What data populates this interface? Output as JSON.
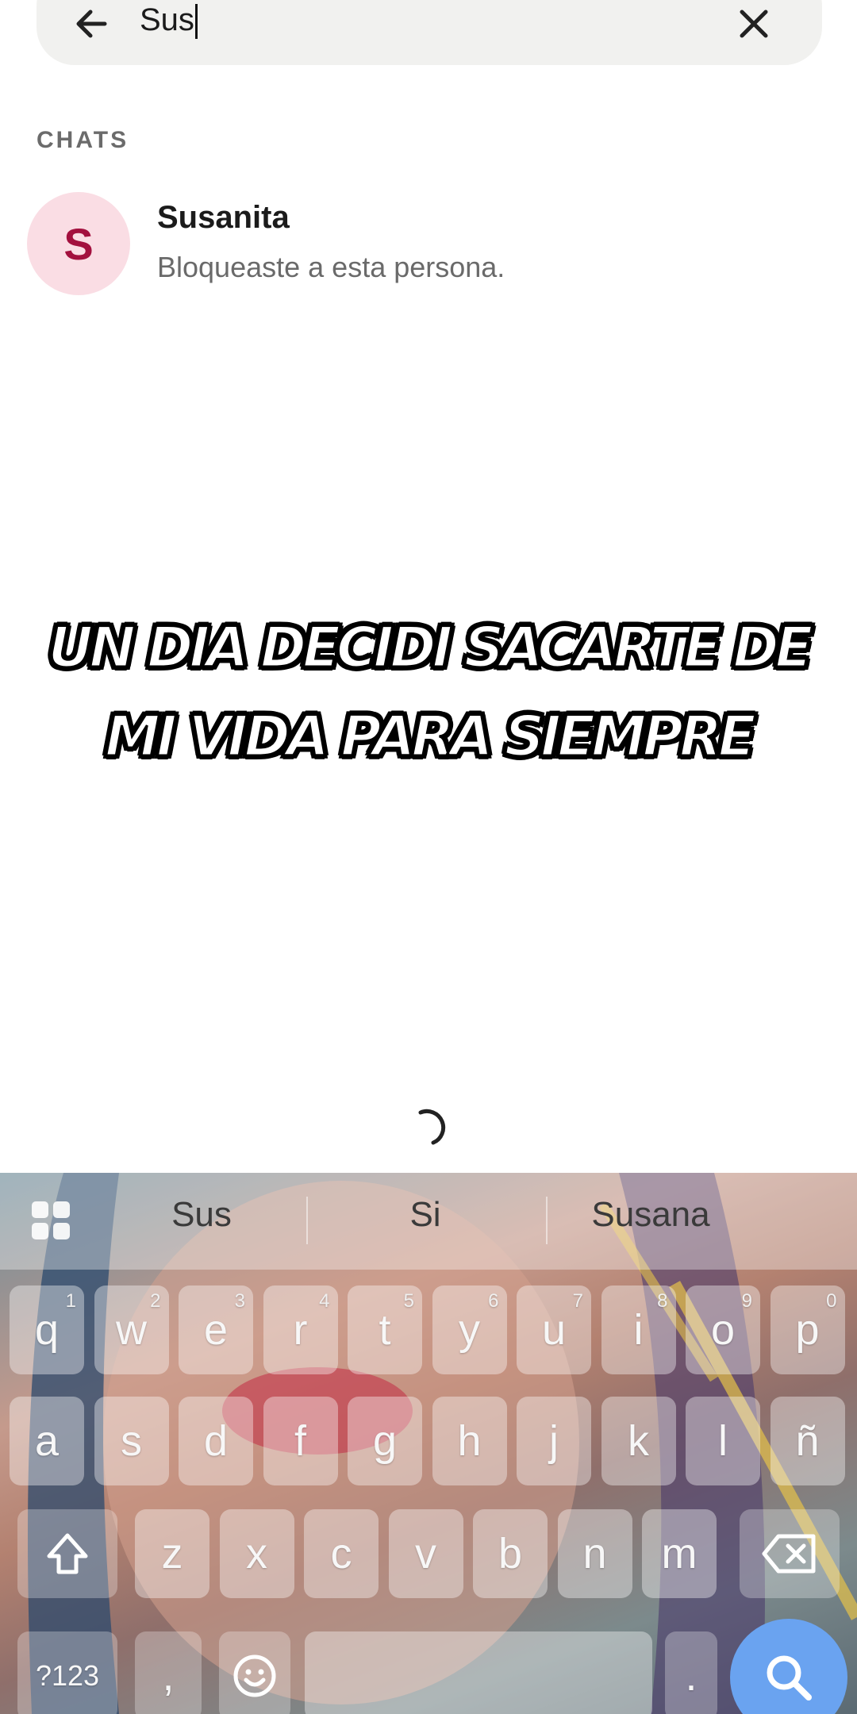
{
  "search": {
    "query": "Sus"
  },
  "results": {
    "section_label": "CHATS",
    "items": [
      {
        "avatar_letter": "S",
        "name": "Susanita",
        "preview": "Bloqueaste a esta persona."
      }
    ]
  },
  "caption": {
    "line1": "UN DIA DECIDI SACARTE DE",
    "line2": "MI VIDA PARA SIEMPRE"
  },
  "keyboard": {
    "suggestions": [
      "Sus",
      "Si",
      "Susana"
    ],
    "row1": [
      {
        "k": "q",
        "h": "1"
      },
      {
        "k": "w",
        "h": "2"
      },
      {
        "k": "e",
        "h": "3"
      },
      {
        "k": "r",
        "h": "4"
      },
      {
        "k": "t",
        "h": "5"
      },
      {
        "k": "y",
        "h": "6"
      },
      {
        "k": "u",
        "h": "7"
      },
      {
        "k": "i",
        "h": "8"
      },
      {
        "k": "o",
        "h": "9"
      },
      {
        "k": "p",
        "h": "0"
      }
    ],
    "row2": [
      "a",
      "s",
      "d",
      "f",
      "g",
      "h",
      "j",
      "k",
      "l",
      "ñ"
    ],
    "row3": [
      "z",
      "x",
      "c",
      "v",
      "b",
      "n",
      "m"
    ],
    "symbols_label": "?123",
    "comma": ",",
    "period": "."
  },
  "colors": {
    "avatar_bg": "#fadde4",
    "avatar_fg": "#a3103e",
    "search_key": "#6aa3f0"
  }
}
